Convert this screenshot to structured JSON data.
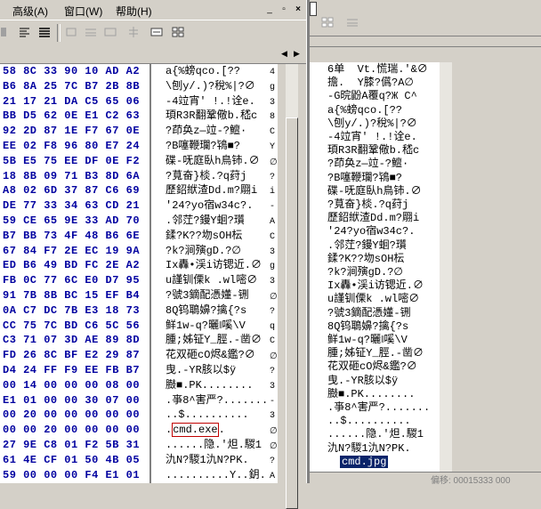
{
  "menubar": {
    "items": [
      {
        "label": "高级(A)"
      },
      {
        "label": "窗口(W)"
      },
      {
        "label": "帮助(H)"
      }
    ],
    "win_controls": {
      "minimize": "_",
      "restore": "▫",
      "close": "×"
    }
  },
  "hex_header": {
    "left_arrow": "◀",
    "right_arrow": "▶"
  },
  "hex_rows": [
    "58 8C 33 90 10 AD A2",
    "B6 8A 25 7C B7 2B 8B",
    "21 17 21 DA C5 65 06",
    "BB D5 62 0E E1 C2 63",
    "92 2D 87 1E F7 67 0E",
    "EE 02 F8 96 80 E7 24",
    "5B E5 75 EE DF 0E F2",
    "18 8B 09 71 B3 8D 6A",
    "A8 02 6D 37 87 C6 69",
    "DE 77 33 34 63 CD 21",
    "59 CE 65 9E 33 AD 70",
    "B7 BB 73 4F 48 B6 6E",
    "67 84 F7 2E EC 19 9A",
    "ED B6 49 BD FC 2E A2",
    "FB 0C 77 6C E0 D7 95",
    "91 7B 8B BC 15 EF B4",
    "0A C7 DC 7B E3 18 73",
    "CC 75 7C BD C6 5C 56",
    "C3 71 07 3D AE 89 8D",
    "FD 26 8C BF E2 29 87",
    "D4 24 FF F9 EE FB B7",
    "00 14 00 00 00 08 00",
    "E1 01 00 00 30 07 00",
    "00 20 00 00 00 00 00",
    "00 00 20 00 00 00 00",
    "27 9E C8 01 F2 5B 31",
    "61 4E CF 01 50 4B 05",
    "59 00 00 00 F4 E1 01"
  ],
  "ascii_rows": [
    "a{%螃qco.[??",
    "\\刨y/.)?稅%|?∅",
    "-4竝宵' !.!诠e.",
    "頊R3R翻鞏儆b.嵇c",
    "?茚奂z—竝-?鱣·",
    "?B噻鞭瓓?鴇■?",
    "碟-呒庭臥h鳥铈.∅",
    "?萈奋}棪.?q荮j",
    "歷鉊絥渣Dd.m?翢i",
    "'24?yo宿w34c?.",
    ".邻茳?鏝Y蛔?瓆",
    "鍒?K??圽sOH枟",
    "?k?涧殥gD.?∅",
    "Ix轟•渓i访锶近.∅",
    "u謹钏傈k .wl嘧∅",
    "?號3鏑配憑嬞-铏",
    "8Q钨鵈嬶?擒{?s",
    "鲜1w-q?曬‖嗘\\V",
    "腫;姊钲Y_脛.-凿∅",
    "花双砸cO烬&鑑?∅",
    "曳.-YR胲以$ÿ",
    "臌■.PK........",
    ".亊8^害严?.......",
    "..$..........",
    ".cmd.exe.",
    "......隐.'炟.騣1",
    "氿N?騣1氿N?PK.",
    "..........Y..鈅."
  ],
  "ascii_highlight": "cmd.exe",
  "ascii_side_chars": [
    "4",
    "g",
    "3",
    "8",
    "C",
    "Y",
    "∅",
    "?",
    "i",
    "-",
    "A",
    "C",
    "3",
    "g",
    "3",
    "∅",
    "?",
    "q",
    "C",
    "∅",
    "?",
    "3",
    "-",
    "3",
    "∅",
    "∅",
    "?",
    "A"
  ],
  "right_rows": [
    "6单  Vt.慌瑞.'&∅",
    "擔.  Y膝?儰?A∅",
    "-G晥鼢A覆q?Ж C^",
    "a{%螃qco.[??",
    "\\刨y/.)?稅%|?∅",
    "-4竝宵' !.!诠e.",
    "頊R3R翻鞏儆b.嵇c",
    "?茚奂z—竝-?鱣·",
    "?B噻鞭瓓?鴇■?",
    "碟-呒庭臥h鳥铈.∅",
    "?萈奋}棪.?q荮j",
    "歷鉊絥渣Dd.m?翢i",
    "'24?yo宿w34c?.",
    ".邻茳?鏝Y蛔?瓆",
    "鍒?K??圽sOH枟",
    "?k?涧殥gD.?∅",
    "Ix轟•渓i访锶近.∅",
    "u謹钏傈k .wl嘧∅",
    "?號3鏑配憑嬞-铏",
    "8Q钨鵈嬶?擒{?s",
    "鲜1w-q?曬‖嗘\\V",
    "腫;姊钲Y_脛.-凿∅",
    "花双砸cO烬&鑑?∅",
    "曳.-YR胲以$ÿ",
    "臌■.PK........",
    ".亊8^害严?.......",
    "..$..........",
    "......隐.'炟.騣1",
    "氿N?騣1氿N?PK."
  ],
  "right_highlight": "cmd.jpg",
  "status": "偏移: 00015333  000"
}
